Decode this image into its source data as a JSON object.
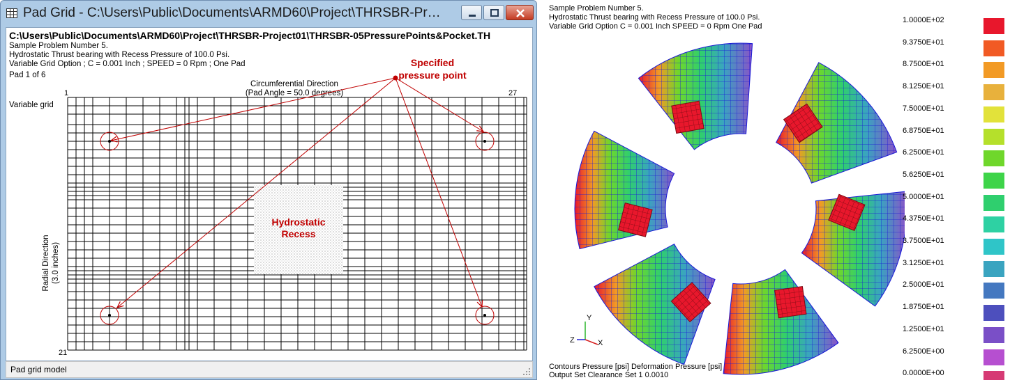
{
  "window": {
    "title": "Pad Grid - C:\\Users\\Public\\Documents\\ARMD60\\Project\\THRSBR-Project01\\TH...",
    "path": "C:\\Users\\Public\\Documents\\ARMD60\\Project\\THRSBR-Project01\\THRSBR-05PressurePoints&Pocket.TH",
    "status": "Pad grid model"
  },
  "grid": {
    "line1": "Sample Problem Number 5.",
    "line2": "Hydrostatic Thrust bearing with Recess Pressure of 100.0 Psi.",
    "line3": "Variable Grid Option ;  C = 0.001 Inch  ;  SPEED = 0 Rpm ; One Pad",
    "pad": "Pad 1 of 6",
    "col_start": "1",
    "col_end": "27",
    "row_end": "21",
    "circ_dir": "Circumferential Direction",
    "pad_angle": "(Pad Angle = 50.0 degrees)",
    "variable_grid": "Variable grid",
    "radial_dir": "Radial Direction",
    "radial_len": "(3.0 inches)",
    "recess_line1": "Hydrostatic",
    "recess_line2": "Recess",
    "spec_line1": "Specified",
    "spec_line2": "pressure point",
    "colors": {
      "annotation": "#c00000",
      "grid": "#000000"
    }
  },
  "plot": {
    "line1": "Sample Problem Number 5.",
    "line2": "Hydrostatic Thrust bearing with Recess Pressure of 100.0 Psi.",
    "line3": "Variable Grid Option    C = 0.001 Inch    SPEED = 0 Rpm   One Pad",
    "footer1": "Contours  Pressure [psi]   Deformation  Pressure [psi]",
    "footer2": "Output Set  Clearance Set   1   0.0010",
    "axis_y": "Y",
    "axis_z": "Z",
    "axis_x": "X",
    "legend": [
      {
        "label": "1.0000E+02",
        "color": "#e8172c"
      },
      {
        "label": "9.3750E+01",
        "color": "#f15a24"
      },
      {
        "label": "8.7500E+01",
        "color": "#f29a25"
      },
      {
        "label": "8.1250E+01",
        "color": "#e8b13c"
      },
      {
        "label": "7.5000E+01",
        "color": "#e2e23a"
      },
      {
        "label": "6.8750E+01",
        "color": "#b5e02b"
      },
      {
        "label": "6.2500E+01",
        "color": "#6fd72b"
      },
      {
        "label": "5.6250E+01",
        "color": "#3ed449"
      },
      {
        "label": "5.0000E+01",
        "color": "#2fcf6e"
      },
      {
        "label": "4.3750E+01",
        "color": "#2ed1a3"
      },
      {
        "label": "3.7500E+01",
        "color": "#2fc5c8"
      },
      {
        "label": "3.1250E+01",
        "color": "#3aa4c0"
      },
      {
        "label": "2.5000E+01",
        "color": "#4478c0"
      },
      {
        "label": "1.8750E+01",
        "color": "#4d4fbd"
      },
      {
        "label": "1.2500E+01",
        "color": "#7a4fc7"
      },
      {
        "label": "6.2500E+00",
        "color": "#b64fd0"
      },
      {
        "label": "0.0000E+00",
        "color": "#d63a74"
      }
    ]
  }
}
